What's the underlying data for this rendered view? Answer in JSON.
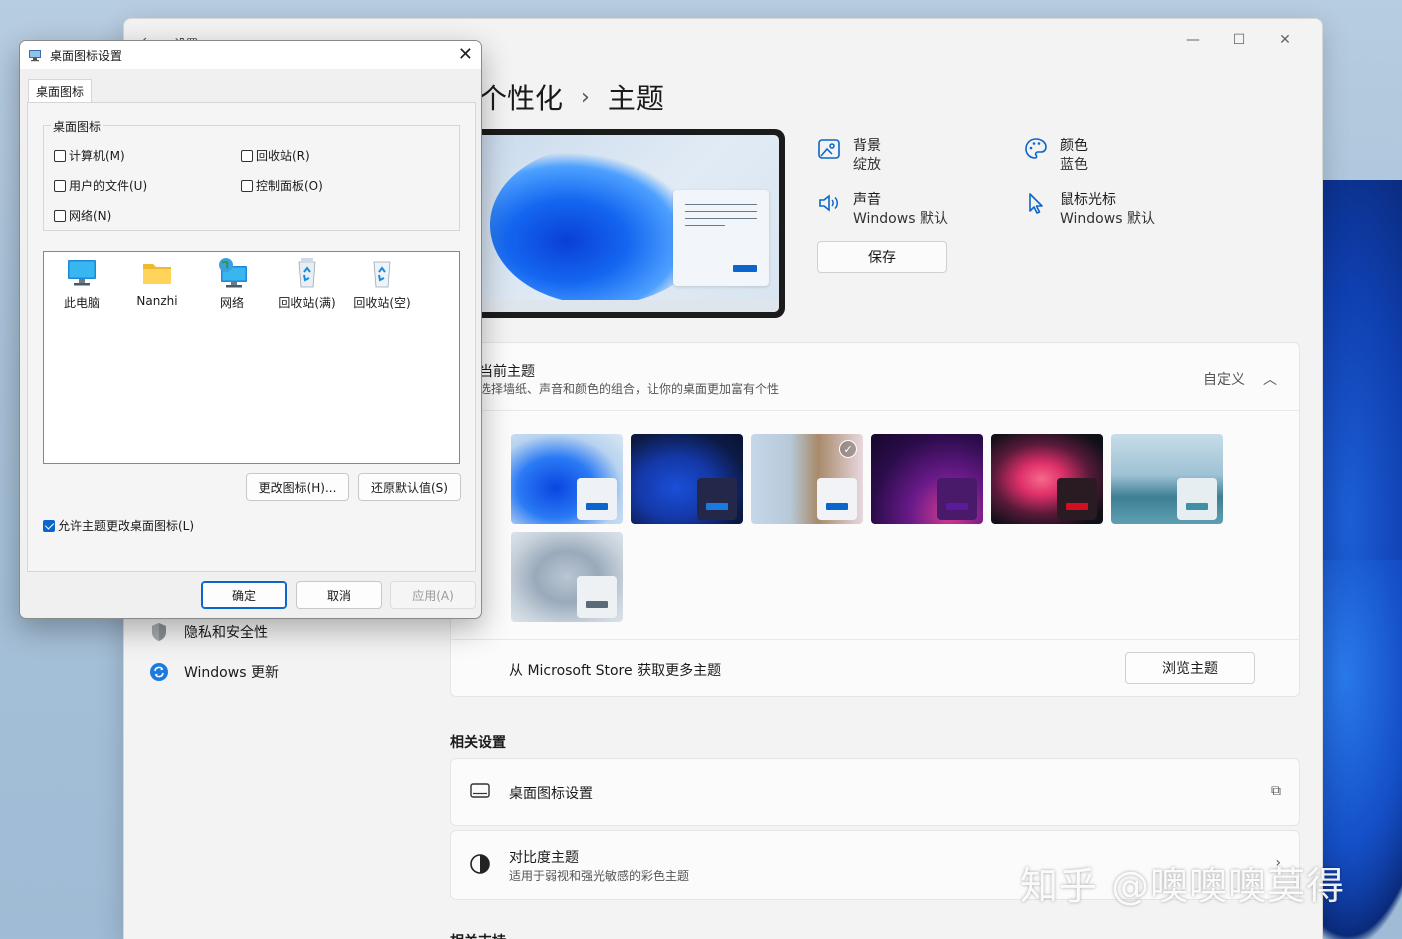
{
  "settings": {
    "app_title": "设置",
    "window_controls": {
      "minimize": "—",
      "maximize": "☐",
      "close": "✕"
    },
    "breadcrumb": {
      "parent": "个性化",
      "separator": "›",
      "current": "主题"
    },
    "props": {
      "background": {
        "label": "背景",
        "value": "绽放"
      },
      "color": {
        "label": "颜色",
        "value": "蓝色"
      },
      "sound": {
        "label": "声音",
        "value": "Windows 默认"
      },
      "cursor": {
        "label": "鼠标光标",
        "value": "Windows 默认"
      }
    },
    "save_label": "保存",
    "current_theme": {
      "title": "当前主题",
      "subtitle": "选择墙纸、声音和颜色的组合，让你的桌面更加富有个性",
      "right_label": "自定义"
    },
    "store": {
      "text": "从 Microsoft Store 获取更多主题",
      "button": "浏览主题"
    },
    "related_settings": {
      "title": "相关设置",
      "desktop_icons": "桌面图标设置",
      "contrast": {
        "title": "对比度主题",
        "subtitle": "适用于弱视和强光敏感的彩色主题"
      }
    },
    "related_support": "相关支持",
    "nav": {
      "privacy": "隐私和安全性",
      "update": "Windows 更新"
    }
  },
  "dialog": {
    "title": "桌面图标设置",
    "tab": "桌面图标",
    "group_title": "桌面图标",
    "checkboxes": {
      "computer": "计算机(M)",
      "recycle": "回收站(R)",
      "user_files": "用户的文件(U)",
      "control_panel": "控制面板(O)",
      "network": "网络(N)"
    },
    "icons": [
      "此电脑",
      "Nanzhi",
      "网络",
      "回收站(满)",
      "回收站(空)"
    ],
    "change_icon": "更改图标(H)...",
    "restore_default": "还原默认值(S)",
    "allow_themes": "允许主题更改桌面图标(L)",
    "ok": "确定",
    "cancel": "取消",
    "apply": "应用(A)"
  },
  "watermark": "知乎 @噢噢噢莫得",
  "colors": {
    "accent": "#0a66cc"
  }
}
